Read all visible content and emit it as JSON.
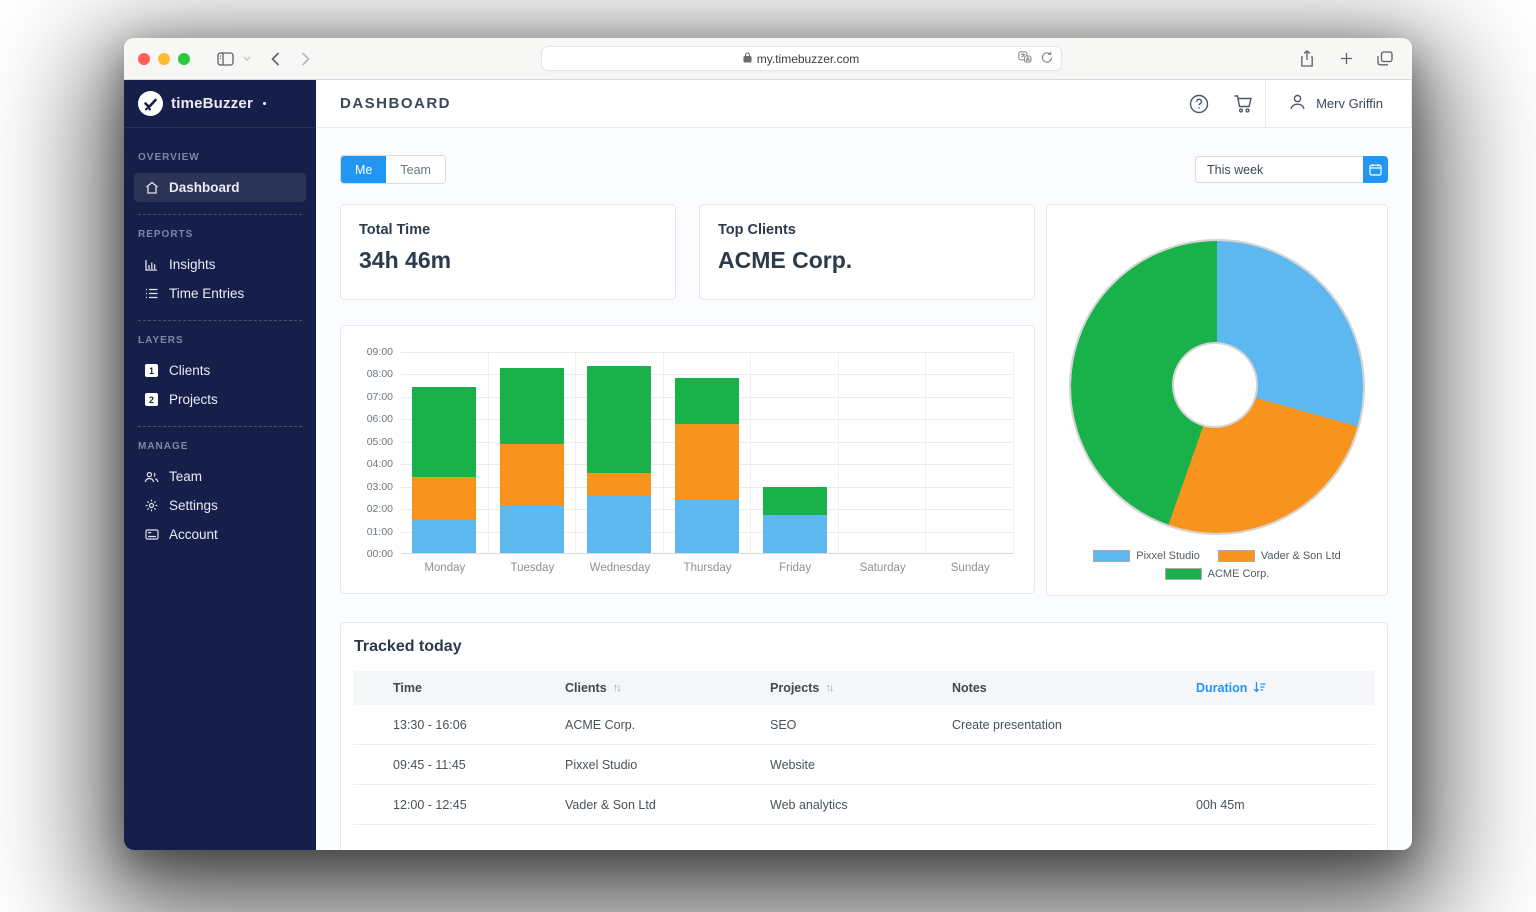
{
  "browser": {
    "url": "my.timebuzzer.com"
  },
  "sidebar": {
    "logo": "timeBuzzer",
    "sections": [
      {
        "label": "OVERVIEW",
        "items": [
          {
            "label": "Dashboard",
            "icon": "home-icon",
            "active": true
          }
        ]
      },
      {
        "label": "REPORTS",
        "items": [
          {
            "label": "Insights",
            "icon": "insights-icon"
          },
          {
            "label": "Time Entries",
            "icon": "time-entries-icon"
          }
        ]
      },
      {
        "label": "LAYERS",
        "items": [
          {
            "label": "Clients",
            "icon": "badge-1-icon",
            "badge": "1"
          },
          {
            "label": "Projects",
            "icon": "badge-2-icon",
            "badge": "2"
          }
        ]
      },
      {
        "label": "MANAGE",
        "items": [
          {
            "label": "Team",
            "icon": "team-icon"
          },
          {
            "label": "Settings",
            "icon": "settings-icon"
          },
          {
            "label": "Account",
            "icon": "account-icon"
          }
        ]
      }
    ]
  },
  "header": {
    "title": "DASHBOARD",
    "user": "Merv Griffin"
  },
  "controls": {
    "me_label": "Me",
    "team_label": "Team",
    "active_toggle": "Me",
    "date_range": "This week"
  },
  "stats": [
    {
      "label": "Total Time",
      "value": "34h 46m"
    },
    {
      "label": "Top Clients",
      "value": "ACME Corp."
    }
  ],
  "colors": {
    "blue": "#5db8f0",
    "orange": "#f8931d",
    "green": "#19b14a",
    "accent": "#2196f3",
    "sidebar": "#161f4a"
  },
  "chart_data": [
    {
      "type": "bar",
      "stacked": true,
      "categories": [
        "Monday",
        "Tuesday",
        "Wednesday",
        "Thursday",
        "Friday",
        "Saturday",
        "Sunday"
      ],
      "series": [
        {
          "name": "Pixxel Studio",
          "color": "#5db8f0",
          "values": [
            1.45,
            2.1,
            2.55,
            2.4,
            1.7,
            0,
            0
          ]
        },
        {
          "name": "Vader & Son Ltd",
          "color": "#f8931d",
          "values": [
            1.95,
            2.75,
            1.0,
            3.35,
            0,
            0,
            0
          ]
        },
        {
          "name": "ACME Corp.",
          "color": "#19b14a",
          "values": [
            4.0,
            3.4,
            4.8,
            2.05,
            1.25,
            0,
            0
          ]
        }
      ],
      "yticks": [
        "00:00",
        "01:00",
        "02:00",
        "03:00",
        "04:00",
        "05:00",
        "06:00",
        "07:00",
        "08:00",
        "09:00"
      ],
      "ylim": [
        0,
        9
      ],
      "grid": true,
      "title": "",
      "xlabel": "",
      "ylabel": ""
    },
    {
      "type": "pie",
      "donut": true,
      "labels": [
        "Pixxel Studio",
        "Vader & Son Ltd",
        "ACME Corp."
      ],
      "values": [
        10.2,
        9.05,
        15.5
      ],
      "colors": [
        "#5db8f0",
        "#f8931d",
        "#19b14a"
      ],
      "legend_position": "bottom"
    }
  ],
  "table": {
    "title": "Tracked today",
    "columns": [
      {
        "label": "Time",
        "sortable": false
      },
      {
        "label": "Clients",
        "sortable": true
      },
      {
        "label": "Projects",
        "sortable": true
      },
      {
        "label": "Notes",
        "sortable": false
      },
      {
        "label": "Duration",
        "sortable": true,
        "sorted": "desc"
      }
    ],
    "rows": [
      {
        "dot": "green",
        "time": "13:30 - 16:06",
        "client": "ACME Corp.",
        "project": "SEO",
        "note": "Create presentation",
        "duration": ""
      },
      {
        "dot": "blue",
        "time": "09:45 - 11:45",
        "client": "Pixxel Studio",
        "project": "Website",
        "note": "",
        "duration": ""
      },
      {
        "dot": "orange",
        "time": "12:00 - 12:45",
        "client": "Vader & Son Ltd",
        "project": "Web analytics",
        "note": "",
        "duration": "00h 45m"
      },
      {
        "dot": "green",
        "time": "",
        "client": "",
        "project": "",
        "note": "",
        "duration": ""
      }
    ]
  }
}
